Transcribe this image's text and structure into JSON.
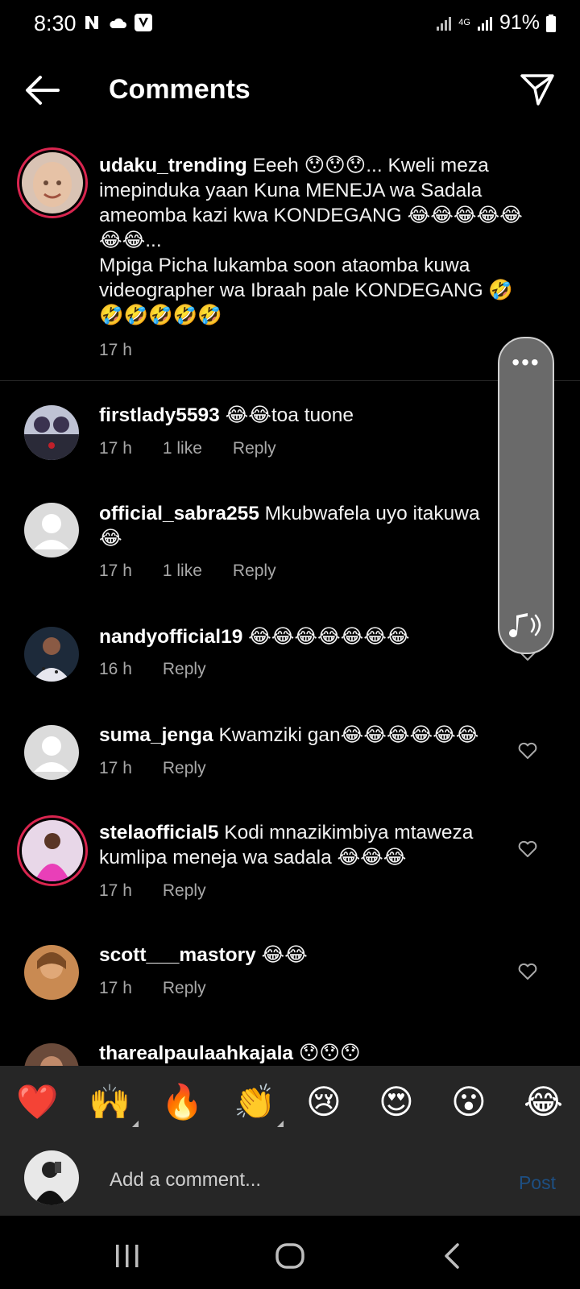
{
  "status": {
    "time": "8:30",
    "network": "4G",
    "battery": "91%"
  },
  "header": {
    "title": "Comments"
  },
  "colors": {
    "ring": "#d9254f",
    "post": "#1d4f83",
    "bar_bg": "#262626"
  },
  "comments": [
    {
      "user": "udaku_trending",
      "text": "Eeeh 😯😯😯... Kweli meza imepinduka yaan Kuna MENEJA wa Sadala ameomba kazi kwa KONDEGANG 😂😂😂😂😂😂😂...",
      "text2": "Mpiga Picha lukamba soon ataomba kuwa videographer wa Ibraah pale KONDEGANG 🤣🤣🤣🤣🤣🤣",
      "time": "17 h"
    },
    {
      "user": "firstlady5593",
      "text": "😂😂toa tuone",
      "time": "17 h",
      "likes": "1 like",
      "reply": "Reply"
    },
    {
      "user": "official_sabra255",
      "text": "Mkubwafela uyo itakuwa 😂",
      "time": "17 h",
      "likes": "1 like",
      "reply": "Reply"
    },
    {
      "user": "nandyofficial19",
      "text": "😂😂😂😂😂😂😂",
      "time": "16 h",
      "reply": "Reply"
    },
    {
      "user": "suma_jenga",
      "text": "Kwamziki gan😂😂😂😂😂😂",
      "time": "17 h",
      "reply": "Reply"
    },
    {
      "user": "stelaofficial5",
      "text": "Kodi mnazikimbiya mtaweza kumlipa meneja wa sadala 😂😂😂",
      "time": "17 h",
      "reply": "Reply"
    },
    {
      "user": "scott___mastory",
      "text": "😂😂",
      "time": "17 h",
      "reply": "Reply"
    },
    {
      "user": "tharealpaulaahkajala",
      "text": "😯😯😯"
    }
  ],
  "reactions": [
    "❤️",
    "🙌",
    "🔥",
    "👏",
    "😢",
    "😍",
    "😮",
    "😂"
  ],
  "input": {
    "placeholder": "Add a comment...",
    "post": "Post"
  }
}
